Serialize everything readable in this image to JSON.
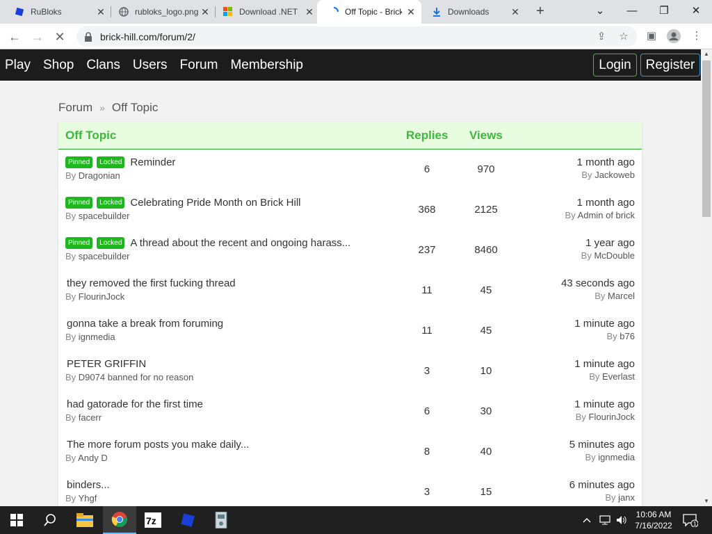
{
  "browser": {
    "tabs": [
      {
        "title": "RuBloks",
        "icon": "rubloks-favicon"
      },
      {
        "title": "rubloks_logo.png",
        "icon": "globe-icon"
      },
      {
        "title": "Download .NET",
        "icon": "microsoft-icon"
      },
      {
        "title": "Off Topic - Brick Hill",
        "icon": "loading-spinner-icon"
      },
      {
        "title": "Downloads",
        "icon": "download-icon"
      }
    ],
    "url": "brick-hill.com/forum/2/"
  },
  "site": {
    "nav": [
      "Play",
      "Shop",
      "Clans",
      "Users",
      "Forum",
      "Membership"
    ],
    "login_label": "Login",
    "register_label": "Register"
  },
  "breadcrumb": {
    "root": "Forum",
    "current": "Off Topic"
  },
  "forum": {
    "header": {
      "title": "Off Topic",
      "replies": "Replies",
      "views": "Views"
    },
    "by_prefix": "By",
    "badges": {
      "pinned": "Pinned",
      "locked": "Locked"
    },
    "threads": [
      {
        "title": "Reminder",
        "author": "Dragonian",
        "replies": "6",
        "views": "970",
        "last_time": "1 month ago",
        "last_by": "Jackoweb",
        "pinned": true,
        "locked": true
      },
      {
        "title": "Celebrating Pride Month on Brick Hill",
        "author": "spacebuilder",
        "replies": "368",
        "views": "2125",
        "last_time": "1 month ago",
        "last_by": "Admin of brick",
        "pinned": true,
        "locked": true
      },
      {
        "title": "A thread about the recent and ongoing harass...",
        "author": "spacebuilder",
        "replies": "237",
        "views": "8460",
        "last_time": "1 year ago",
        "last_by": "McDouble",
        "pinned": true,
        "locked": true
      },
      {
        "title": "they removed the first fucking thread",
        "author": "FlourinJock",
        "replies": "11",
        "views": "45",
        "last_time": "43 seconds ago",
        "last_by": "Marcel",
        "pinned": false,
        "locked": false
      },
      {
        "title": "gonna take a break from foruming",
        "author": "ignmedia",
        "replies": "11",
        "views": "45",
        "last_time": "1 minute ago",
        "last_by": "b76",
        "pinned": false,
        "locked": false
      },
      {
        "title": "PETER GRIFFIN",
        "author": "D9074 banned for no reason",
        "replies": "3",
        "views": "10",
        "last_time": "1 minute ago",
        "last_by": "Everlast",
        "pinned": false,
        "locked": false
      },
      {
        "title": "had gatorade for the first time",
        "author": "facerr",
        "replies": "6",
        "views": "30",
        "last_time": "1 minute ago",
        "last_by": "FlourinJock",
        "pinned": false,
        "locked": false
      },
      {
        "title": "The more forum posts you make daily...",
        "author": "Andy D",
        "replies": "8",
        "views": "40",
        "last_time": "5 minutes ago",
        "last_by": "ignmedia",
        "pinned": false,
        "locked": false
      },
      {
        "title": "binders...",
        "author": "Yhgf",
        "replies": "3",
        "views": "15",
        "last_time": "6 minutes ago",
        "last_by": "janx",
        "pinned": false,
        "locked": false
      }
    ]
  },
  "taskbar": {
    "apps": [
      "start-icon",
      "search-icon",
      "file-explorer-icon",
      "chrome-icon",
      "7zip-icon",
      "rubloks-icon",
      "app-icon"
    ],
    "time": "10:06 AM",
    "date": "7/16/2022",
    "notification_count": "1"
  },
  "colors": {
    "accent_green": "#3db83d",
    "badge_green": "#1eb81e",
    "nav_bg": "#1c1c1c",
    "header_bg": "#e8fde0"
  }
}
